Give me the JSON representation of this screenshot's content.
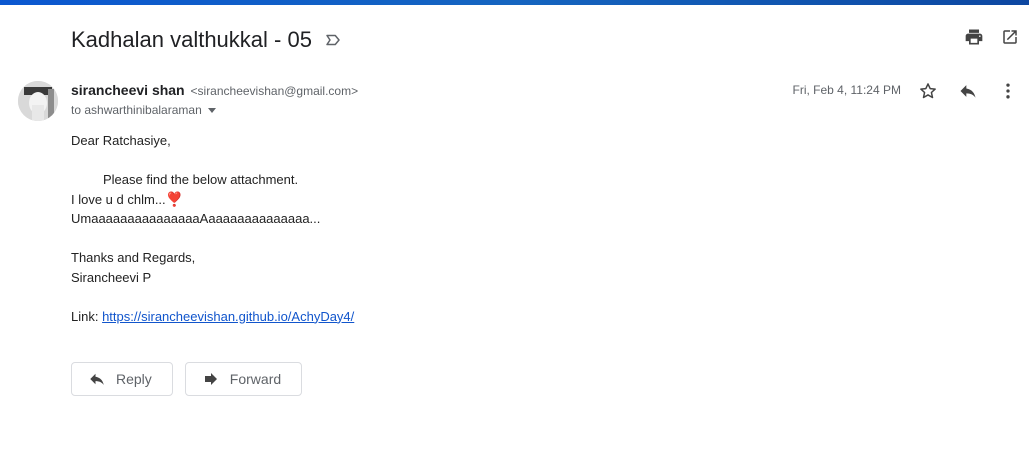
{
  "subject": "Kadhalan valthukkal - 05",
  "header_icons": [
    "label-icon",
    "print-icon",
    "open-in-new-window-icon"
  ],
  "sender": {
    "name": "sirancheevi shan",
    "email": "<sirancheevishan@gmail.com>",
    "to": "to ashwarthinibalaraman",
    "date": "Fri, Feb 4, 11:24 PM"
  },
  "message_icons": [
    "star-icon",
    "reply-icon",
    "more-vert-icon"
  ],
  "body": {
    "greeting": "Dear Ratchasiye,",
    "line1": "Please find the below attachment.",
    "line2_text": "I love u d  chlm...",
    "line2_emoji": "❣️",
    "line3": "UmaaaaaaaaaaaaaaaAaaaaaaaaaaaaaa...",
    "closing": "Thanks and Regards,",
    "signature": "Sirancheevi P",
    "link_label": "Link: ",
    "link_url": "https://sirancheevishan.github.io/AchyDay4/"
  },
  "actions": {
    "reply": "Reply",
    "forward": "Forward"
  },
  "colors": {
    "accent": "#0b57d0",
    "link": "#1155cc",
    "text": "#202124",
    "muted": "#5f6368"
  }
}
